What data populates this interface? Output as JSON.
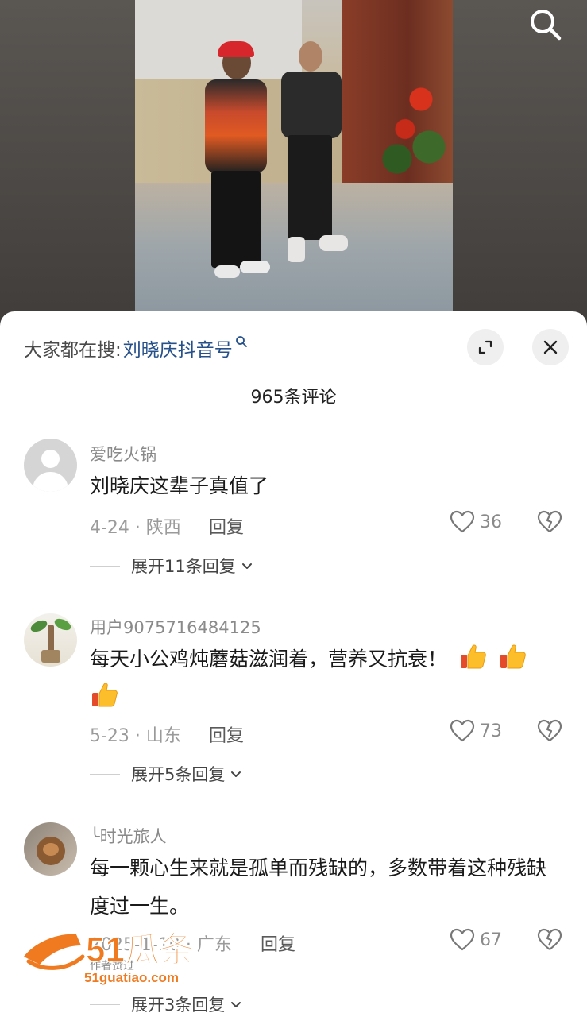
{
  "header": {
    "hot_search_prefix": "大家都在搜:",
    "hot_search_term": "刘晓庆抖音号",
    "hot_search_icon": "search-small-icon"
  },
  "comment_count_label": "965条评论",
  "comments": [
    {
      "username": "爱吃火锅",
      "text": "刘晓庆这辈子真值了",
      "date_location": "4-24 · 陕西",
      "reply_label": "回复",
      "likes": "36",
      "expand_label": "展开11条回复"
    },
    {
      "username": "用户9075716484125",
      "text": "每天小公鸡炖蘑菇滋润着，营养又抗衰！",
      "emojis": [
        "thumbs-up-emoji",
        "thumbs-up-emoji",
        "thumbs-up-emoji"
      ],
      "date_location": "5-23 · 山东",
      "reply_label": "回复",
      "likes": "73",
      "expand_label": "展开5条回复"
    },
    {
      "username": "╰时光旅人",
      "text": "每一颗心生来就是孤单而残缺的，多数带着这种残缺度过一生。",
      "date_location": "2025-1-10 · 广东",
      "author_liked": "作者赞过",
      "reply_label": "回复",
      "likes": "67",
      "expand_label": "展开3条回复"
    }
  ],
  "watermark": {
    "brand": "51瓜条",
    "url": "51guatiao.com"
  },
  "colors": {
    "link_blue": "#25508a",
    "watermark_orange": "#f07a1f"
  }
}
